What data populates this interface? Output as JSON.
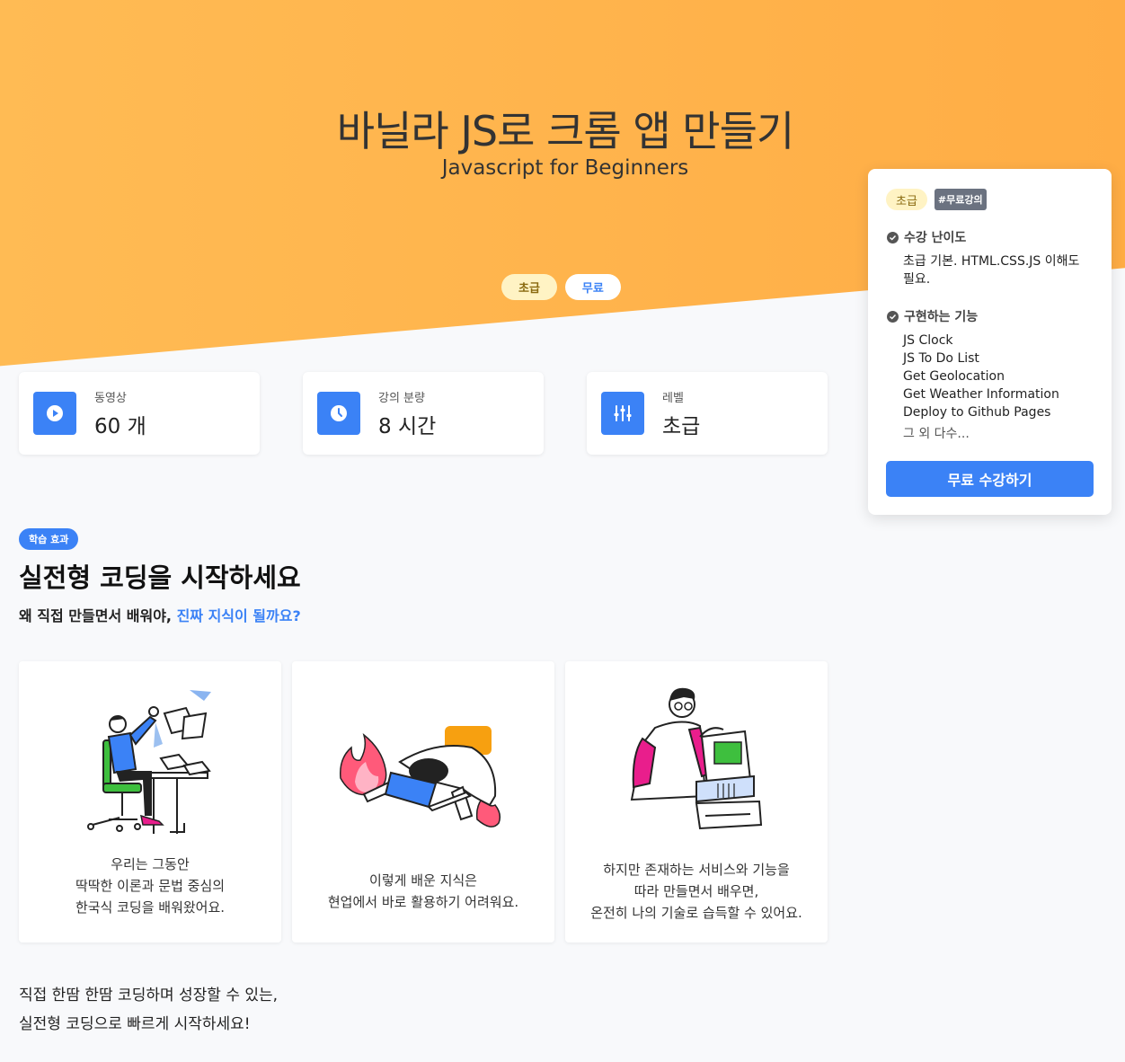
{
  "hero": {
    "title": "바닐라 JS로 크롬 앱 만들기",
    "subtitle": "Javascript for Beginners",
    "tags": [
      "초급",
      "무료"
    ]
  },
  "stats": [
    {
      "icon": "play-icon",
      "label": "동영상",
      "value": "60 개"
    },
    {
      "icon": "clock-icon",
      "label": "강의 분량",
      "value": "8 시간"
    },
    {
      "icon": "sliders-icon",
      "label": "레벨",
      "value": "초급"
    }
  ],
  "section": {
    "badge": "학습 효과",
    "title": "실전형 코딩을 시작하세요",
    "desc_plain": "왜 직접 만들면서 배워야, ",
    "desc_highlight": "진짜 지식이 될까요?"
  },
  "features": [
    {
      "icon": "frustrated-student-illustration",
      "lines": [
        "우리는 그동안",
        "딱딱한 이론과 문법 중심의",
        "한국식 코딩을 배워왔어요."
      ]
    },
    {
      "icon": "burnout-illustration",
      "lines": [
        "이렇게 배운 지식은",
        "현업에서 바로 활용하기 어려워요."
      ]
    },
    {
      "icon": "developer-computer-illustration",
      "lines": [
        "하지만 존재하는 서비스와 기능을",
        "따라 만들면서 배우면,",
        "온전히 나의 기술로 습득할 수 있어요."
      ]
    }
  ],
  "bottom": {
    "line1": "직접 한땀 한땀 코딩하며 성장할 수 있는,",
    "line2": "실전형 코딩으로 빠르게 시작하세요!"
  },
  "sidebar": {
    "tag_level": "초급",
    "tag_free": "#무료강의",
    "difficulty_heading": "수강 난이도",
    "difficulty_text": [
      "초급 기본. HTML.CSS.JS 이해도",
      "필요."
    ],
    "features_heading": "구현하는 기능",
    "features_list": [
      "JS Clock",
      "JS To Do List",
      "Get Geolocation",
      "Get Weather Information",
      "Deploy to Github Pages"
    ],
    "features_more": "그 외 다수...",
    "cta": "무료 수강하기"
  },
  "colors": {
    "accent": "#3b82f6",
    "hero_bg": "#ffb04c",
    "page_bg": "#f8f9fb"
  }
}
